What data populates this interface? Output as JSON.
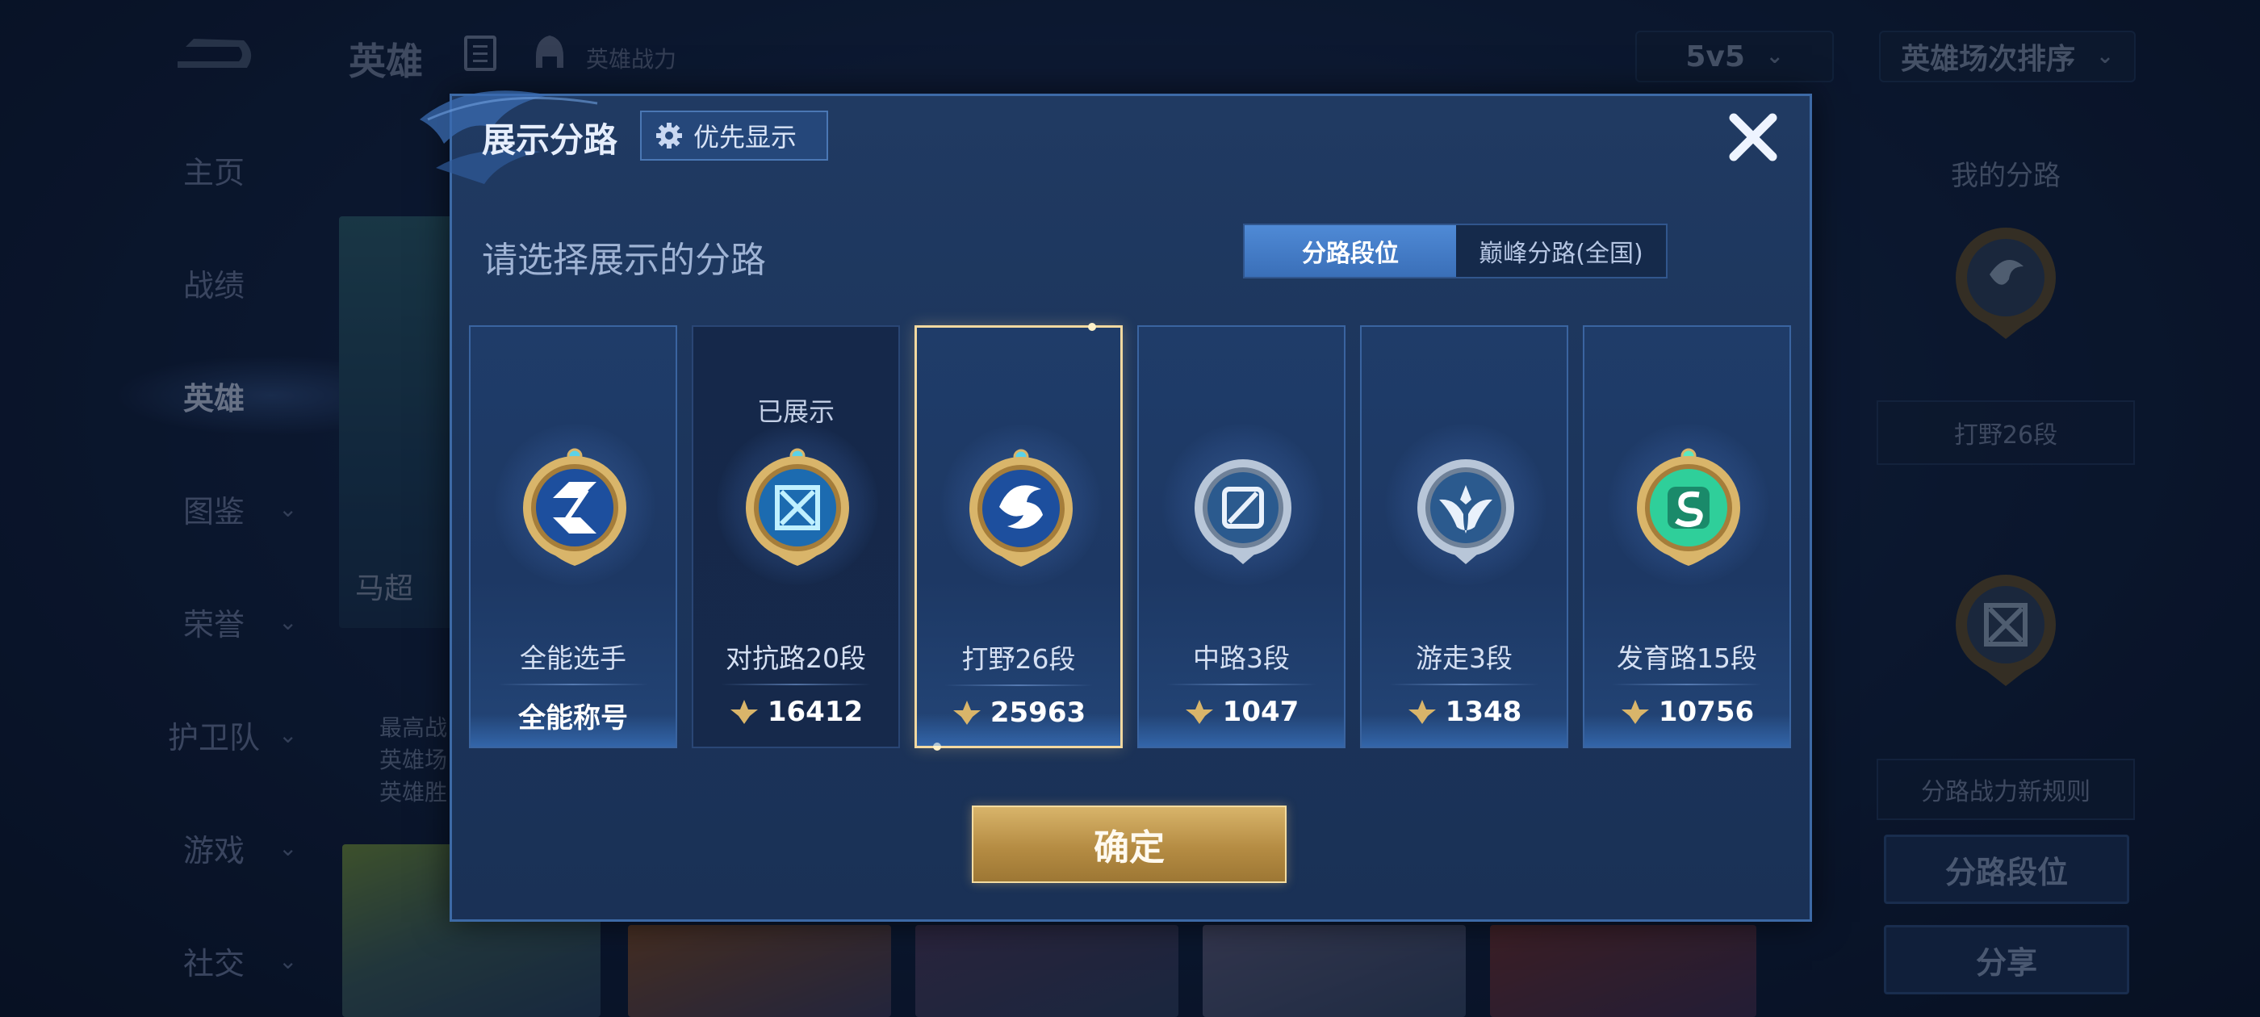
{
  "app": {
    "page_title": "英雄",
    "power_label": "英雄战力"
  },
  "filters": {
    "mode": "5v5",
    "sort": "英雄场次排序"
  },
  "sidebar": {
    "items": [
      {
        "label": "主页"
      },
      {
        "label": "战绩"
      },
      {
        "label": "英雄"
      },
      {
        "label": "图鉴"
      },
      {
        "label": "荣誉"
      },
      {
        "label": "护卫队"
      },
      {
        "label": "游戏"
      },
      {
        "label": "社交"
      }
    ]
  },
  "background_hero": {
    "name": "马超",
    "stats": [
      "最高战",
      "英雄场",
      "英雄胜"
    ]
  },
  "right_panel": {
    "title": "我的分路",
    "current_lane": "打野26段",
    "rules_link": "分路战力新规则",
    "lane_rank_button": "分路段位",
    "share_button": "分享"
  },
  "modal": {
    "title": "展示分路",
    "priority_button": "优先显示",
    "subtitle": "请选择展示的分路",
    "tabs": [
      {
        "label": "分路段位",
        "active": true
      },
      {
        "label": "巅峰分路(全国)",
        "active": false
      }
    ],
    "lanes": [
      {
        "name": "全能选手",
        "value": "全能称号",
        "has_score_icon": false,
        "shown_label": "",
        "badge": "all-round-badge-icon",
        "selected": false
      },
      {
        "name": "对抗路20段",
        "value": "16412",
        "has_score_icon": true,
        "shown_label": "已展示",
        "badge": "clash-lane-badge-icon",
        "selected": false
      },
      {
        "name": "打野26段",
        "value": "25963",
        "has_score_icon": true,
        "shown_label": "",
        "badge": "jungle-badge-icon",
        "selected": true
      },
      {
        "name": "中路3段",
        "value": "1047",
        "has_score_icon": true,
        "shown_label": "",
        "badge": "mid-lane-badge-icon",
        "selected": false
      },
      {
        "name": "游走3段",
        "value": "1348",
        "has_score_icon": true,
        "shown_label": "",
        "badge": "roam-badge-icon",
        "selected": false
      },
      {
        "name": "发育路15段",
        "value": "10756",
        "has_score_icon": true,
        "shown_label": "",
        "badge": "farm-lane-badge-icon",
        "selected": false
      }
    ],
    "confirm_button": "确定"
  },
  "colors": {
    "gold": "#d9b56a",
    "silver": "#b8c6d8",
    "accent_blue": "#4f8ad6",
    "farm_green": "#2fcf9a"
  }
}
